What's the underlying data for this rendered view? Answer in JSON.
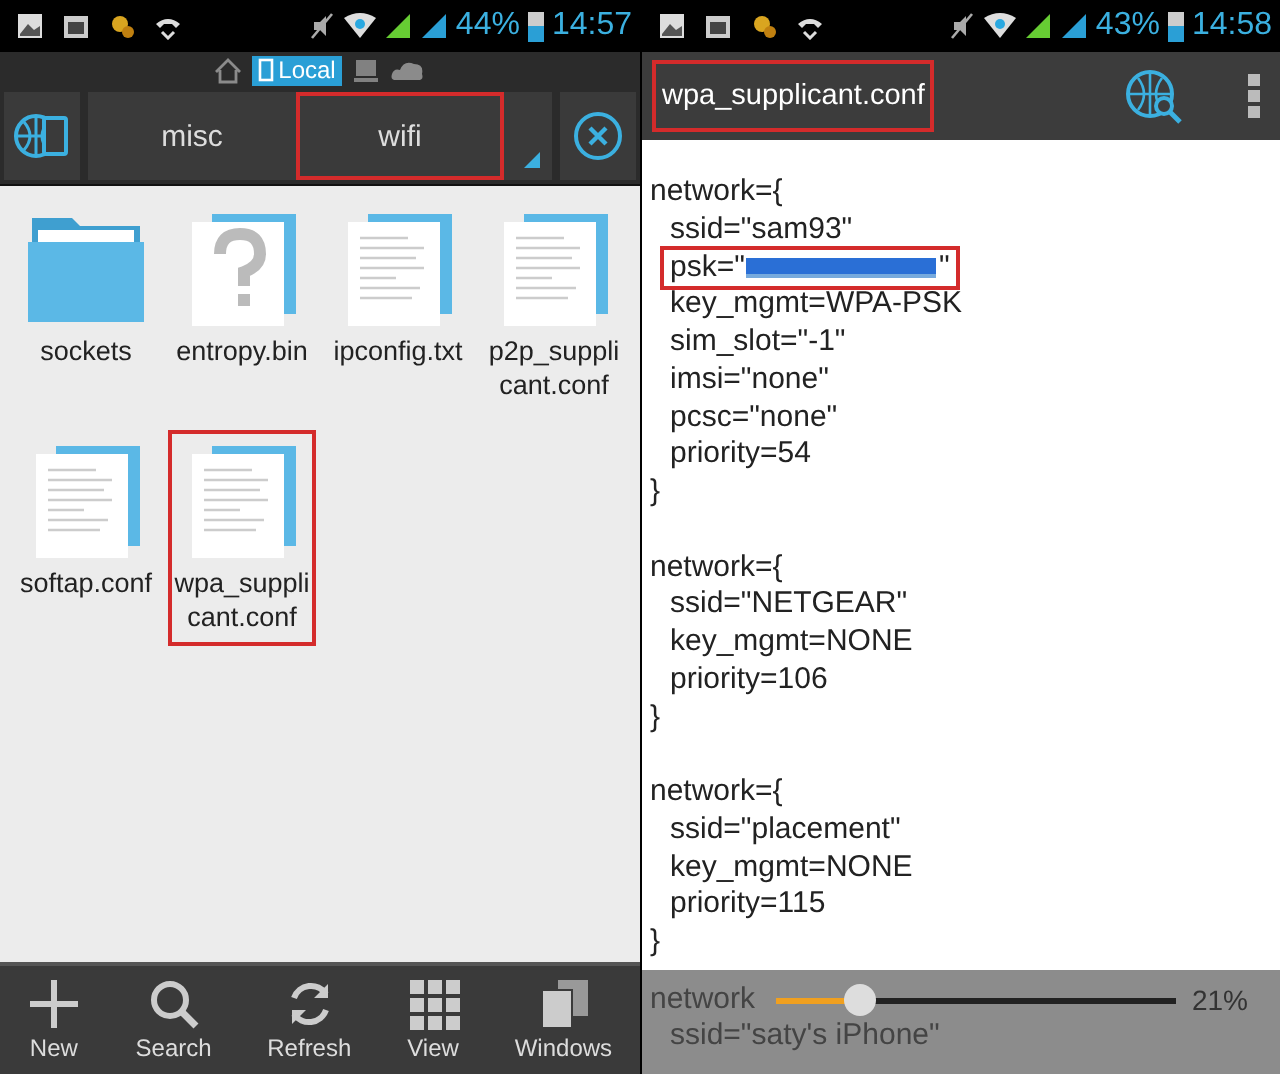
{
  "left_phone": {
    "status_bar": {
      "battery": "44%",
      "time": "14:57"
    },
    "location_bar": {
      "items": [
        {
          "kind": "home",
          "selected": false
        },
        {
          "kind": "local",
          "label": "Local",
          "selected": true
        },
        {
          "kind": "pc",
          "selected": false
        },
        {
          "kind": "cloud",
          "selected": false
        }
      ]
    },
    "breadcrumbs": [
      {
        "label": "misc",
        "selected": false
      },
      {
        "label": "wifi",
        "selected": true
      }
    ],
    "files": [
      {
        "name": "sockets",
        "kind": "folder",
        "selected": false
      },
      {
        "name": "entropy.bin",
        "kind": "unknown",
        "selected": false
      },
      {
        "name": "ipconfig.txt",
        "kind": "text",
        "selected": false
      },
      {
        "name": "p2p_suppli cant.conf",
        "kind": "text",
        "selected": false
      },
      {
        "name": "softap.conf",
        "kind": "text",
        "selected": false
      },
      {
        "name": "wpa_suppli cant.conf",
        "kind": "text",
        "selected": true
      }
    ],
    "toolbar": [
      {
        "label": "New",
        "kind": "plus"
      },
      {
        "label": "Search",
        "kind": "search"
      },
      {
        "label": "Refresh",
        "kind": "refresh"
      },
      {
        "label": "View",
        "kind": "grid"
      },
      {
        "label": "Windows",
        "kind": "windows"
      }
    ]
  },
  "right_phone": {
    "status_bar": {
      "battery": "43%",
      "time": "14:58"
    },
    "title": "wpa_supplicant.conf",
    "blocks": [
      {
        "open": "network={",
        "fields": [
          {
            "text": "ssid=\"sam93\"",
            "kind": "plain",
            "highlighted": false
          },
          {
            "text": "psk=\"",
            "suffix": "\"",
            "kind": "redacted",
            "highlighted": true
          },
          {
            "text": "key_mgmt=WPA-PSK",
            "kind": "plain",
            "highlighted": false
          },
          {
            "text": "sim_slot=\"-1\"",
            "kind": "plain",
            "highlighted": false
          },
          {
            "text": "imsi=\"none\"",
            "kind": "plain",
            "highlighted": false
          },
          {
            "text": "pcsc=\"none\"",
            "kind": "plain",
            "highlighted": false
          },
          {
            "text": "priority=54",
            "kind": "plain",
            "highlighted": false
          }
        ],
        "close": "}"
      },
      {
        "open": "network={",
        "fields": [
          {
            "text": "ssid=\"NETGEAR\"",
            "kind": "plain",
            "highlighted": false
          },
          {
            "text": "key_mgmt=NONE",
            "kind": "plain",
            "highlighted": false
          },
          {
            "text": "priority=106",
            "kind": "plain",
            "highlighted": false
          }
        ],
        "close": "}"
      },
      {
        "open": "network={",
        "fields": [
          {
            "text": "ssid=\"placement\"",
            "kind": "plain",
            "highlighted": false
          },
          {
            "text": "key_mgmt=NONE",
            "kind": "plain",
            "highlighted": false
          },
          {
            "text": "priority=115",
            "kind": "plain",
            "highlighted": false
          }
        ],
        "close": "}"
      }
    ],
    "overlay": {
      "line_1": "network",
      "line_2": "ssid=\"saty's iPhone\"",
      "slider": {
        "level": 0.21
      },
      "reading": "21%"
    }
  }
}
